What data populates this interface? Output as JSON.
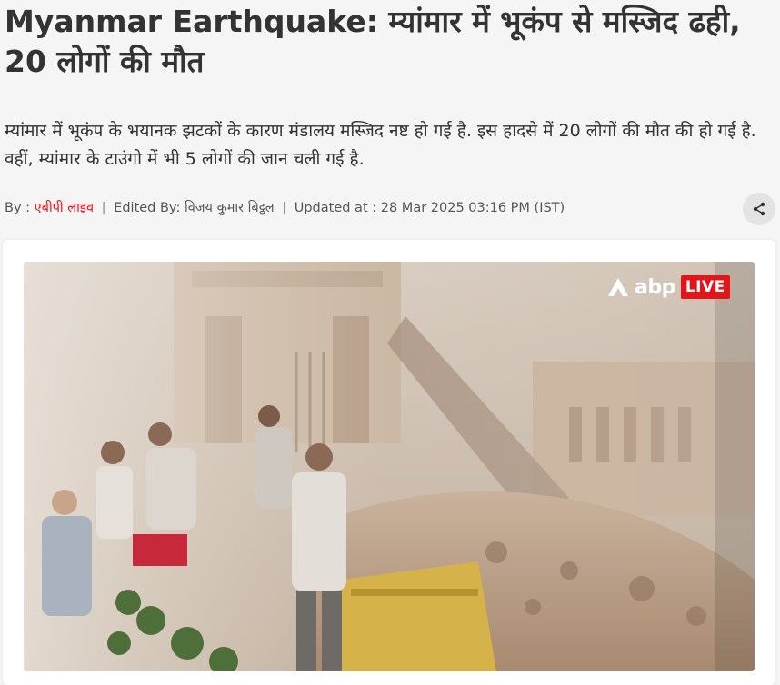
{
  "article": {
    "headline": "Myanmar Earthquake: म्यांमार में भूकंप से मस्जिद ढही, 20 लोगों की मौत",
    "summary": "म्यांमार में भूकंप के भयानक झटकों के कारण मंडालय मस्जिद नष्ट हो गई है. इस हादसे में 20 लोगों की मौत की हो गई है. वहीं, म्यांमार के टाउंगो में भी 5 लोगों की जान चली गई है.",
    "byline": {
      "by_label": "By :",
      "author": "एबीपी लाइव",
      "edited_label": "Edited By:",
      "editor": "विजय कुमार बिट्ठल",
      "updated_label": "Updated at :",
      "updated_at": "28 Mar 2025 03:16 PM (IST)"
    },
    "share_icon": "share-icon"
  },
  "media": {
    "description_icon": "photo",
    "logo_text": "abp",
    "live_label": "LIVE",
    "colors": {
      "live": "#e3151b",
      "author": "#e0141a"
    }
  }
}
